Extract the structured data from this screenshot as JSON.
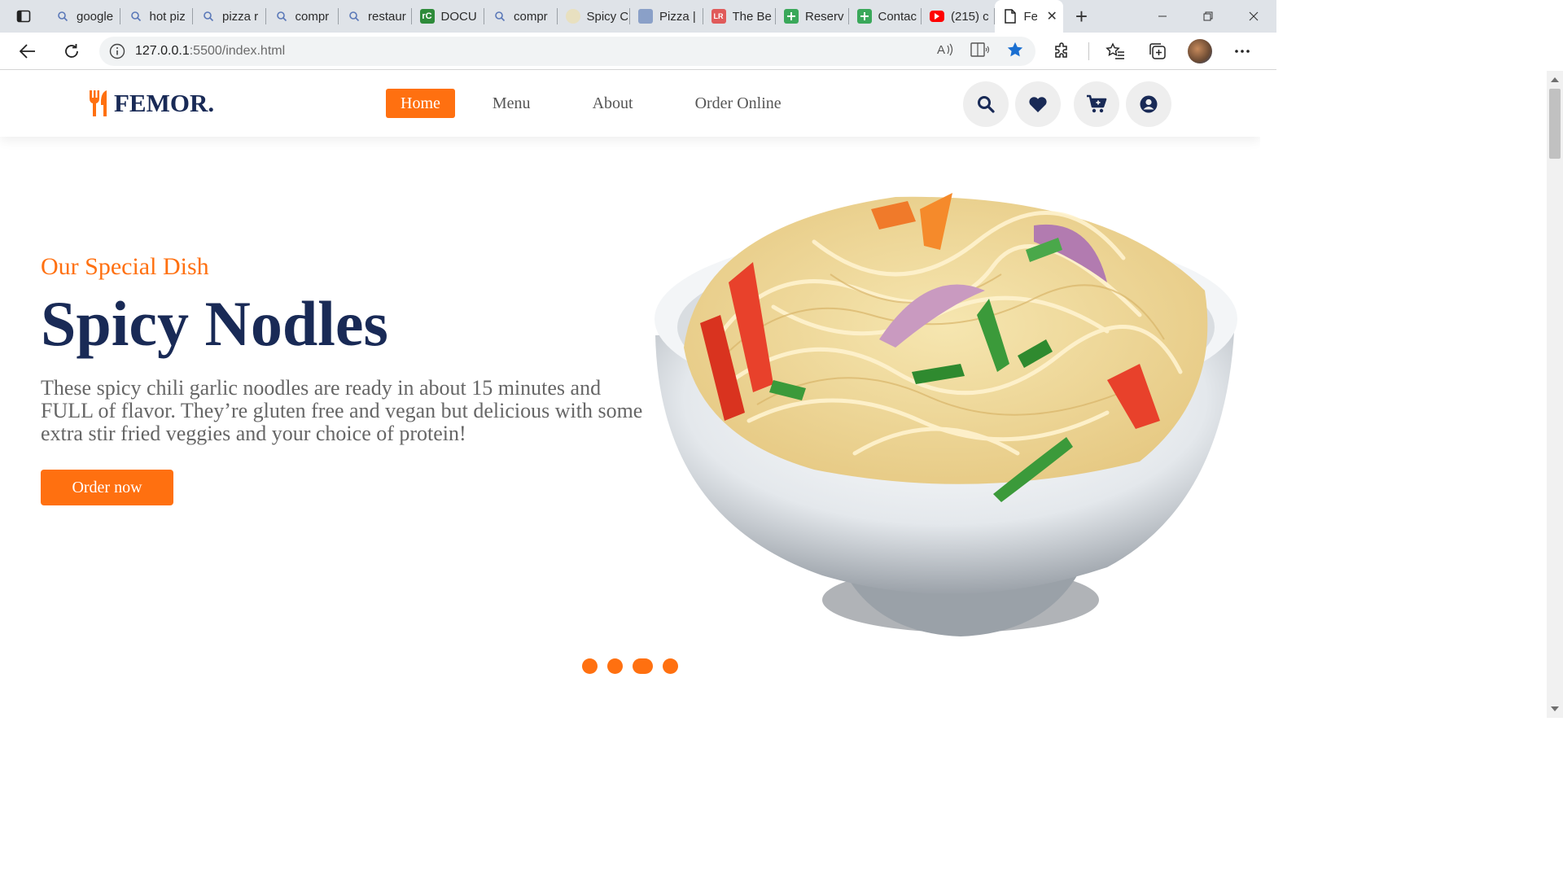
{
  "browser": {
    "tabs": [
      {
        "label": "google",
        "icon": "search-icon"
      },
      {
        "label": "hot piz",
        "icon": "search-icon"
      },
      {
        "label": "pizza r",
        "icon": "search-icon"
      },
      {
        "label": "compr",
        "icon": "search-icon"
      },
      {
        "label": "restaur",
        "icon": "search-icon"
      },
      {
        "label": "DOCU",
        "icon": "rc-favicon",
        "fav_text": "rC",
        "fav_color": "#2e8b3a"
      },
      {
        "label": "compr",
        "icon": "search-icon"
      },
      {
        "label": "Spicy C",
        "icon": "note-favicon",
        "fav_color": "#e8e0c0"
      },
      {
        "label": "Pizza |",
        "icon": "pizza-favicon",
        "fav_color": "#8aa0c8"
      },
      {
        "label": "The Be",
        "icon": "lr-favicon",
        "fav_text": "LR",
        "fav_color": "#e05a5a"
      },
      {
        "label": "Reserv",
        "icon": "plus-favicon",
        "fav_color": "#3aa85a"
      },
      {
        "label": "Contac",
        "icon": "plus-favicon",
        "fav_color": "#3aa85a"
      },
      {
        "label": "(215) c",
        "icon": "youtube-icon",
        "fav_color": "#ff0000"
      }
    ],
    "active_tab": {
      "label": "Fe"
    },
    "address": {
      "host": "127.0.0.1",
      "rest": ":5500/index.html"
    }
  },
  "site": {
    "logo_text": "FEMOR.",
    "nav": [
      {
        "label": "Home",
        "active": true
      },
      {
        "label": "Menu"
      },
      {
        "label": "About"
      },
      {
        "label": "Order Online"
      }
    ]
  },
  "hero": {
    "subtitle": "Our Special Dish",
    "title": "Spicy Nodles",
    "description": "These spicy chili garlic noodles are ready in about 15 minutes and FULL of flavor. They’re gluten free and vegan but delicious with some extra stir fried veggies and your choice of protein!",
    "cta_label": "Order now"
  },
  "slider": {
    "count": 4,
    "active_index": 3
  },
  "colors": {
    "accent": "#ff7010",
    "brand_dark": "#192a56",
    "text_muted": "#666666"
  }
}
